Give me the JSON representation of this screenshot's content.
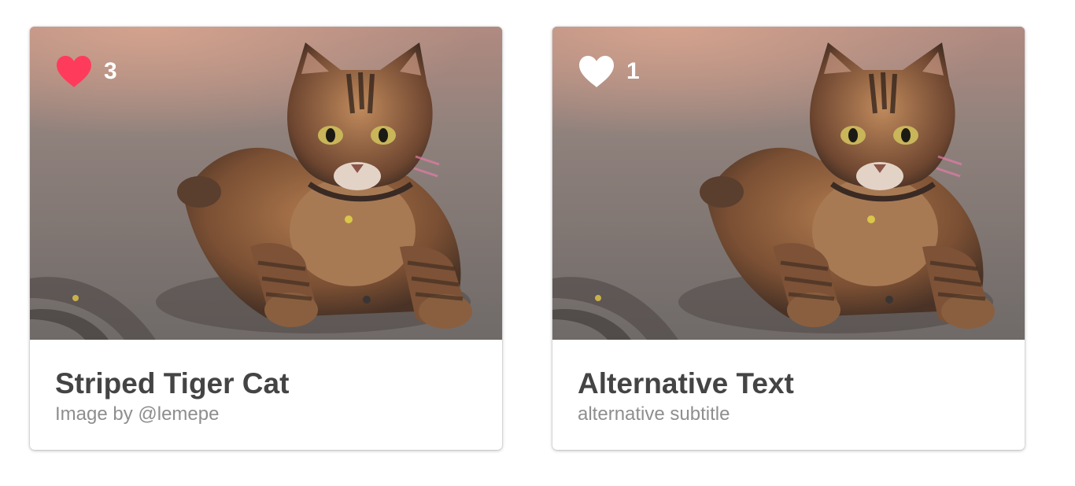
{
  "cards": [
    {
      "title": "Striped Tiger Cat",
      "subtitle": "Image by @lemepe",
      "likes": "3",
      "liked": true,
      "heart_icon": "heart-icon",
      "heart_color": "#ff3b5c"
    },
    {
      "title": "Alternative Text",
      "subtitle": "alternative subtitle",
      "likes": "1",
      "liked": false,
      "heart_icon": "heart-icon",
      "heart_color": "#ffffff"
    }
  ]
}
